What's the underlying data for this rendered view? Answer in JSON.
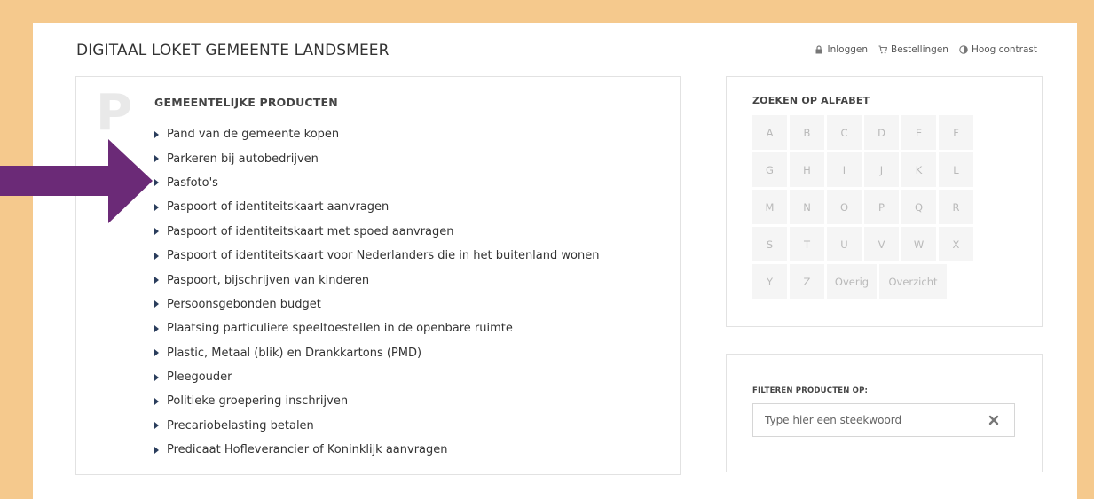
{
  "header": {
    "site_title": "DIGITAAL LOKET GEMEENTE LANDSMEER",
    "links": [
      {
        "label": "Inloggen",
        "icon": "lock-icon"
      },
      {
        "label": "Bestellingen",
        "icon": "cart-icon"
      },
      {
        "label": "Hoog contrast",
        "icon": "contrast-icon"
      }
    ]
  },
  "products": {
    "letter": "P",
    "heading": "GEMEENTELIJKE PRODUCTEN",
    "items": [
      "Pand van de gemeente kopen",
      "Parkeren bij autobedrijven",
      "Pasfoto's",
      "Paspoort of identiteitskaart aanvragen",
      "Paspoort of identiteitskaart met spoed aanvragen",
      "Paspoort of identiteitskaart voor Nederlanders die in het buitenland wonen",
      "Paspoort, bijschrijven van kinderen",
      "Persoonsgebonden budget",
      "Plaatsing particuliere speeltoestellen in de openbare ruimte",
      "Plastic, Metaal (blik) en Drankkartons (PMD)",
      "Pleegouder",
      "Politieke groepering inschrijven",
      "Precariobelasting betalen",
      "Predicaat Hofleverancier of Koninklijk aanvragen"
    ]
  },
  "alphabet": {
    "heading": "ZOEKEN OP ALFABET",
    "rows": [
      [
        "A",
        "B",
        "C",
        "D",
        "E",
        "F"
      ],
      [
        "G",
        "H",
        "I",
        "J",
        "K",
        "L"
      ],
      [
        "M",
        "N",
        "O",
        "P",
        "Q",
        "R"
      ],
      [
        "S",
        "T",
        "U",
        "V",
        "W",
        "X"
      ],
      [
        "Y",
        "Z",
        "Overig",
        "Overzicht"
      ]
    ]
  },
  "filter": {
    "heading": "FILTEREN PRODUCTEN OP:",
    "placeholder": "Type hier een steekwoord",
    "clear_icon": "close-icon"
  },
  "annotation": {
    "arrow_color": "#6b2a77",
    "arrow_icon": "right-arrow-icon"
  },
  "colors": {
    "page_border": "#f5c98d",
    "list_bullet": "#2a3d5c",
    "alpha_bg": "#f5f5f5",
    "alpha_text": "#b9b9b9"
  }
}
